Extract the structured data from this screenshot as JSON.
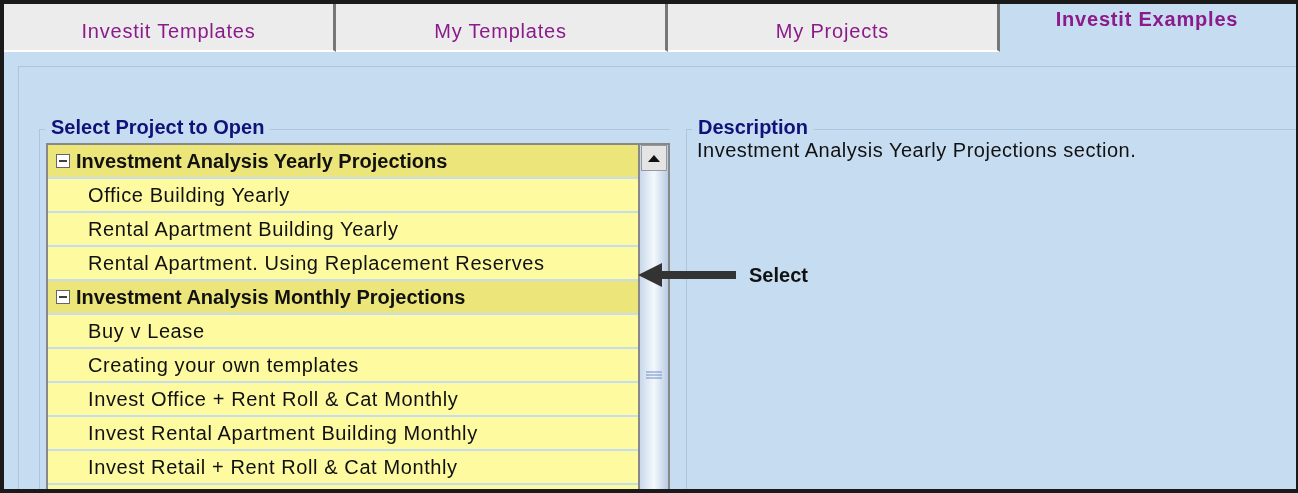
{
  "tabs": [
    {
      "label": "Investit Templates",
      "selected": false
    },
    {
      "label": "My Templates",
      "selected": false
    },
    {
      "label": "My Projects",
      "selected": false
    },
    {
      "label": "Investit Examples",
      "selected": true
    }
  ],
  "project_panel": {
    "title": "Select Project to Open",
    "tree": [
      {
        "label": "Investment Analysis Yearly Projections",
        "expanded": true,
        "children": [
          {
            "label": "Office Building Yearly"
          },
          {
            "label": "Rental Apartment Building Yearly"
          },
          {
            "label": "Rental Apartment. Using Replacement Reserves"
          }
        ]
      },
      {
        "label": "Investment Analysis Monthly Projections",
        "expanded": true,
        "children": [
          {
            "label": "Buy v Lease"
          },
          {
            "label": "Creating your own templates"
          },
          {
            "label": "Invest Office + Rent Roll & Cat Monthly"
          },
          {
            "label": "Invest Rental Apartment Building Monthly"
          },
          {
            "label": "Invest Retail + Rent Roll & Cat Monthly"
          }
        ]
      }
    ]
  },
  "description_panel": {
    "title": "Description",
    "text": "Investment Analysis Yearly Projections section."
  },
  "annotation": {
    "label": "Select"
  }
}
